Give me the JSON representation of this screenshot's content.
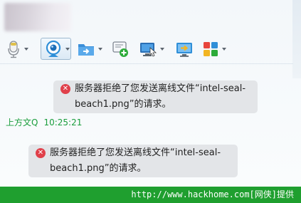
{
  "toolbar": {
    "buttons": [
      {
        "icon": "microphone-icon"
      },
      {
        "icon": "webcam-icon"
      },
      {
        "icon": "send-file-icon"
      },
      {
        "icon": "add-contact-icon"
      },
      {
        "icon": "remote-desktop-icon"
      },
      {
        "icon": "share-screen-icon"
      },
      {
        "icon": "apps-icon"
      }
    ]
  },
  "messages": [
    {
      "icon": "error-icon",
      "line1": "服务器拒绝了您发送离线文件“intel-seal-",
      "line2": "beach1.png”的请求。"
    },
    {
      "icon": "error-icon",
      "line1": "服务器拒绝了您发送离线文件“intel-seal-",
      "line2": "beach1.png”的请求。"
    }
  ],
  "sender": {
    "name": "上方文Q",
    "time": "10:25:21"
  },
  "footer": {
    "text": "http://www.hackhome.com[网侠]提供"
  },
  "colors": {
    "sender_green": "#1a9d3c",
    "footer_green": "#1f9f2f",
    "error_red": "#e0404a",
    "bubble_gray": "#e3e5e8"
  }
}
